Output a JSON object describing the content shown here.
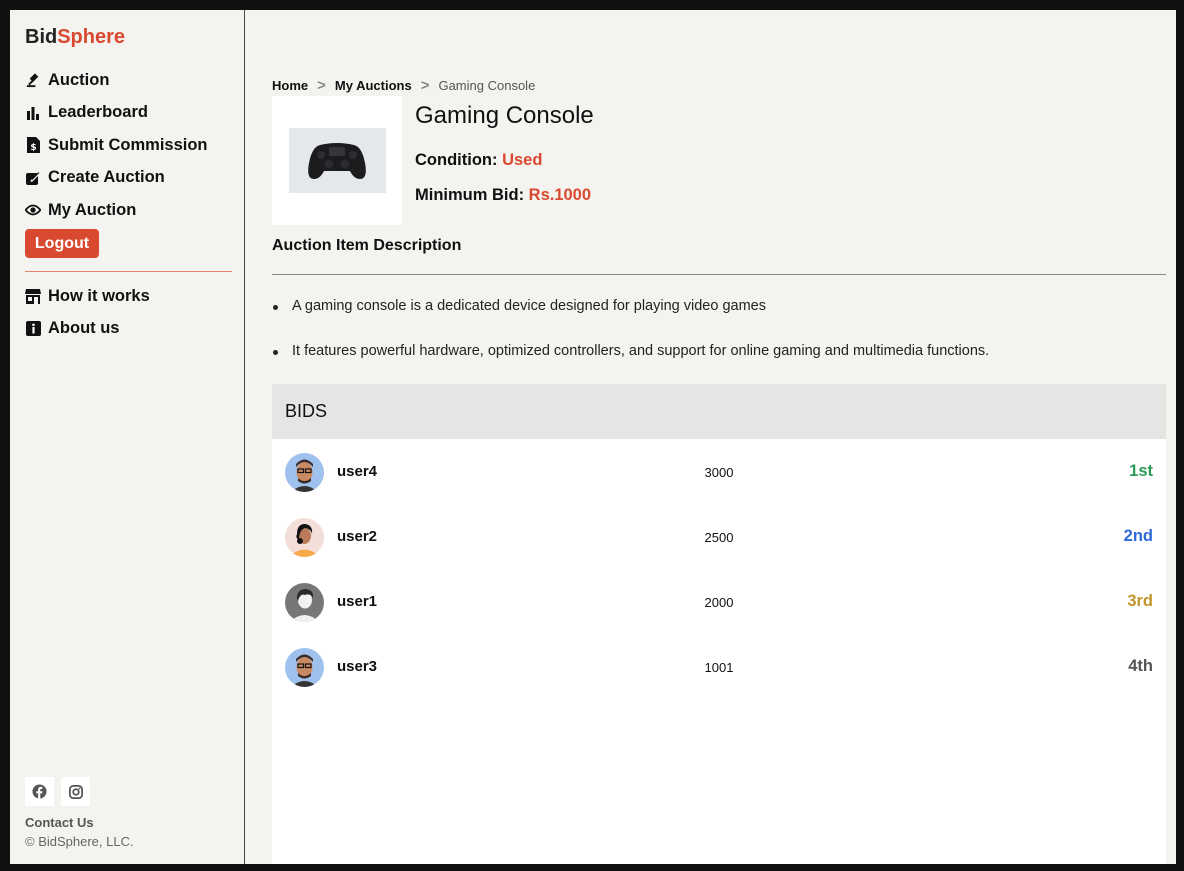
{
  "brand": {
    "part1": "Bid",
    "part2": "Sphere"
  },
  "sidebar": {
    "items": [
      {
        "label": "Auction",
        "icon": "gavel-icon"
      },
      {
        "label": "Leaderboard",
        "icon": "bar-chart-icon"
      },
      {
        "label": "Submit Commission",
        "icon": "money-file-icon"
      },
      {
        "label": "Create Auction",
        "icon": "edit-icon"
      },
      {
        "label": "My Auction",
        "icon": "eye-icon"
      }
    ],
    "logout_label": "Logout",
    "secondary": [
      {
        "label": "How it works",
        "icon": "shop-icon"
      },
      {
        "label": "About us",
        "icon": "info-icon"
      }
    ],
    "social": [
      "facebook-icon",
      "instagram-icon"
    ],
    "contact_label": "Contact Us",
    "copyright": "© BidSphere, LLC."
  },
  "breadcrumb": {
    "home": "Home",
    "parent": "My Auctions",
    "current": "Gaming Console",
    "separator": ">"
  },
  "item": {
    "title": "Gaming Console",
    "condition_label": "Condition: ",
    "condition_value": "Used",
    "min_bid_label": "Minimum Bid: ",
    "min_bid_value": "Rs.1000",
    "image_icon": "gamepad-icon"
  },
  "description": {
    "heading": "Auction Item Description",
    "points": [
      "A gaming console is a dedicated device designed for playing video games",
      "It features powerful hardware, optimized controllers, and support for online gaming and multimedia functions."
    ]
  },
  "bids": {
    "heading": "BIDS",
    "rows": [
      {
        "user": "user4",
        "amount": "3000",
        "rank": "1st",
        "rank_color": "#2e9a57",
        "avatar": "avatar-man-glasses"
      },
      {
        "user": "user2",
        "amount": "2500",
        "rank": "2nd",
        "rank_color": "#2d6ad9",
        "avatar": "avatar-woman"
      },
      {
        "user": "user1",
        "amount": "2000",
        "rank": "3rd",
        "rank_color": "#c0962a",
        "avatar": "avatar-default"
      },
      {
        "user": "user3",
        "amount": "1001",
        "rank": "4th",
        "rank_color": "#555555",
        "avatar": "avatar-man-glasses"
      }
    ]
  },
  "colors": {
    "accent": "#d9492f",
    "background": "#f4f3f0"
  }
}
